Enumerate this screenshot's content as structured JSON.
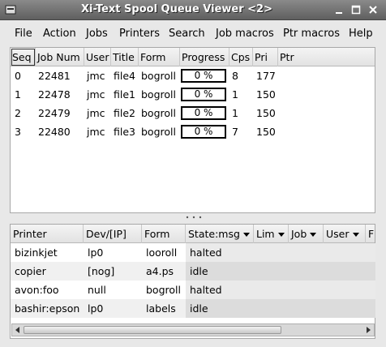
{
  "window": {
    "title": "Xi-Text Spool Queue Viewer <2>"
  },
  "menu": {
    "items": [
      "File",
      "Action",
      "Jobs",
      "Printers",
      "Search",
      "Job macros",
      "Ptr macros",
      "Help"
    ]
  },
  "jobs": {
    "columns": [
      "Seq",
      "Job Num",
      "User",
      "Title",
      "Form",
      "Progress",
      "Cps",
      "Pri",
      "Ptr"
    ],
    "rows": [
      {
        "seq": "0",
        "job_num": "22481",
        "user": "jmc",
        "title": "file4",
        "form": "bogroll",
        "progress": "0 %",
        "cps": "8",
        "pri": "177",
        "ptr": ""
      },
      {
        "seq": "1",
        "job_num": "22478",
        "user": "jmc",
        "title": "file1",
        "form": "bogroll",
        "progress": "0 %",
        "cps": "1",
        "pri": "150",
        "ptr": ""
      },
      {
        "seq": "2",
        "job_num": "22479",
        "user": "jmc",
        "title": "file2",
        "form": "bogroll",
        "progress": "0 %",
        "cps": "1",
        "pri": "150",
        "ptr": ""
      },
      {
        "seq": "3",
        "job_num": "22480",
        "user": "jmc",
        "title": "file3",
        "form": "bogroll",
        "progress": "0 %",
        "cps": "7",
        "pri": "150",
        "ptr": ""
      }
    ]
  },
  "printers": {
    "columns": [
      "Printer",
      "Dev/[IP]",
      "Form",
      "State:msg",
      "Lim",
      "Job",
      "User",
      "F"
    ],
    "rows": [
      {
        "printer": "bizinkjet",
        "dev": "lp0",
        "form": "looroll",
        "state": "halted"
      },
      {
        "printer": "copier",
        "dev": "[nog]",
        "form": "a4.ps",
        "state": "idle"
      },
      {
        "printer": "avon:foo",
        "dev": "null",
        "form": "bogroll",
        "state": "halted"
      },
      {
        "printer": "bashir:epson",
        "dev": "lp0",
        "form": "labels",
        "state": "idle"
      }
    ]
  },
  "colors": {
    "titlebar": "#6e6e6e",
    "background": "#e8e8e8",
    "state_column": "#eaeaea"
  }
}
